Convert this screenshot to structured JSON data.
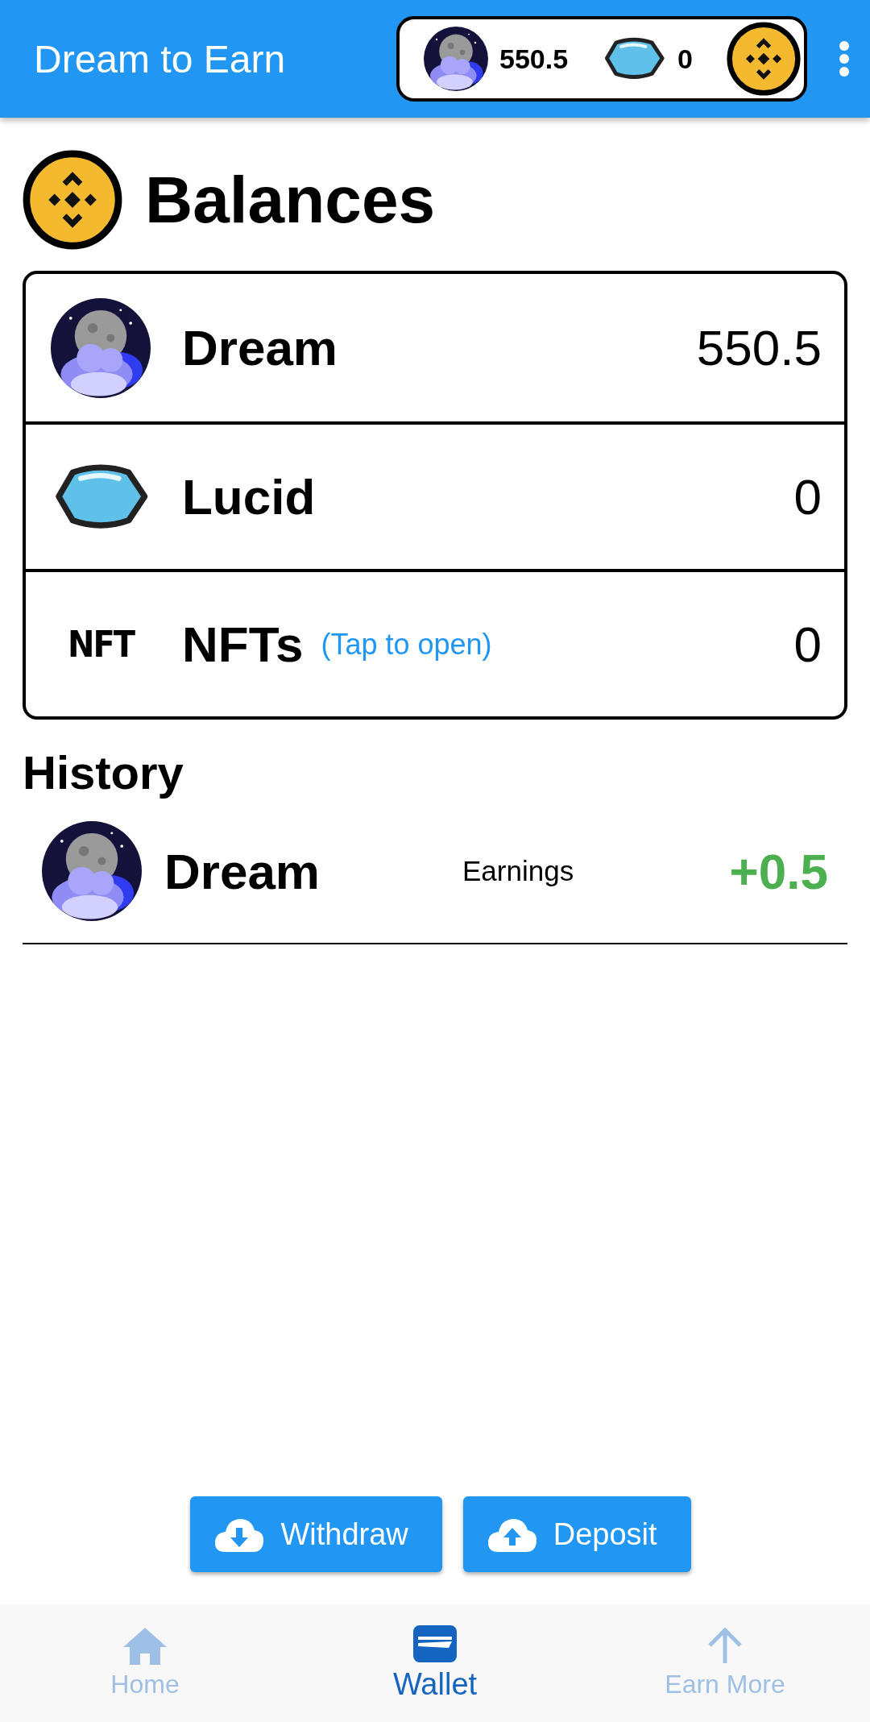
{
  "app_bar": {
    "title": "Dream to Earn",
    "wallet_chip": {
      "items": [
        {
          "kind": "dream",
          "amount": "550.5"
        },
        {
          "kind": "lucid",
          "amount": "0"
        }
      ]
    }
  },
  "balances": {
    "title": "Balances",
    "rows": [
      {
        "kind": "dream",
        "name": "Dream",
        "value": "550.5"
      },
      {
        "kind": "lucid",
        "name": "Lucid",
        "value": "0"
      },
      {
        "kind": "nft",
        "icon_text": "NFT",
        "name": "NFTs",
        "hint": "(Tap to open)",
        "value": "0"
      }
    ]
  },
  "history": {
    "title": "History",
    "rows": [
      {
        "kind": "dream",
        "name": "Dream",
        "type": "Earnings",
        "amount": "+0.5"
      }
    ]
  },
  "actions": [
    {
      "kind": "download",
      "label": "Withdraw"
    },
    {
      "kind": "upload",
      "label": "Deposit"
    }
  ],
  "bottom_nav": [
    {
      "kind": "home",
      "label": "Home",
      "selected": false
    },
    {
      "kind": "wallet",
      "label": "Wallet",
      "selected": true
    },
    {
      "kind": "arrow",
      "label": "Earn More",
      "selected": false
    }
  ]
}
